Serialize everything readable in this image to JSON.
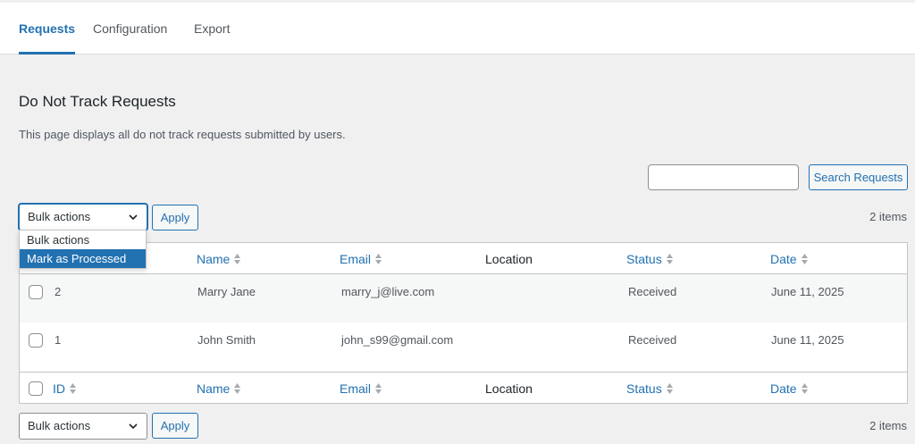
{
  "tabs": [
    {
      "label": "Requests",
      "active": true
    },
    {
      "label": "Configuration",
      "active": false
    },
    {
      "label": "Export",
      "active": false
    }
  ],
  "page": {
    "title": "Do Not Track Requests",
    "description": "This page displays all do not track requests submitted by users."
  },
  "search": {
    "value": "",
    "button_label": "Search Requests"
  },
  "bulk_top": {
    "selected": "Bulk actions",
    "apply_label": "Apply",
    "options": [
      "Bulk actions",
      "Mark as Processed"
    ],
    "highlighted_option": "Mark as Processed"
  },
  "bulk_bottom": {
    "selected": "Bulk actions",
    "apply_label": "Apply"
  },
  "item_count": "2 items",
  "table": {
    "columns": [
      "ID",
      "Name",
      "Email",
      "Location",
      "Status",
      "Date"
    ],
    "rows": [
      {
        "id": "2",
        "name": "Marry Jane",
        "email": "marry_j@live.com",
        "location": "",
        "status": "Received",
        "date": "June 11, 2025"
      },
      {
        "id": "1",
        "name": "John Smith",
        "email": "john_s99@gmail.com",
        "location": "",
        "status": "Received",
        "date": "June 11, 2025"
      }
    ]
  },
  "colors": {
    "accent": "#2271b1",
    "background": "#f0f0f1"
  }
}
